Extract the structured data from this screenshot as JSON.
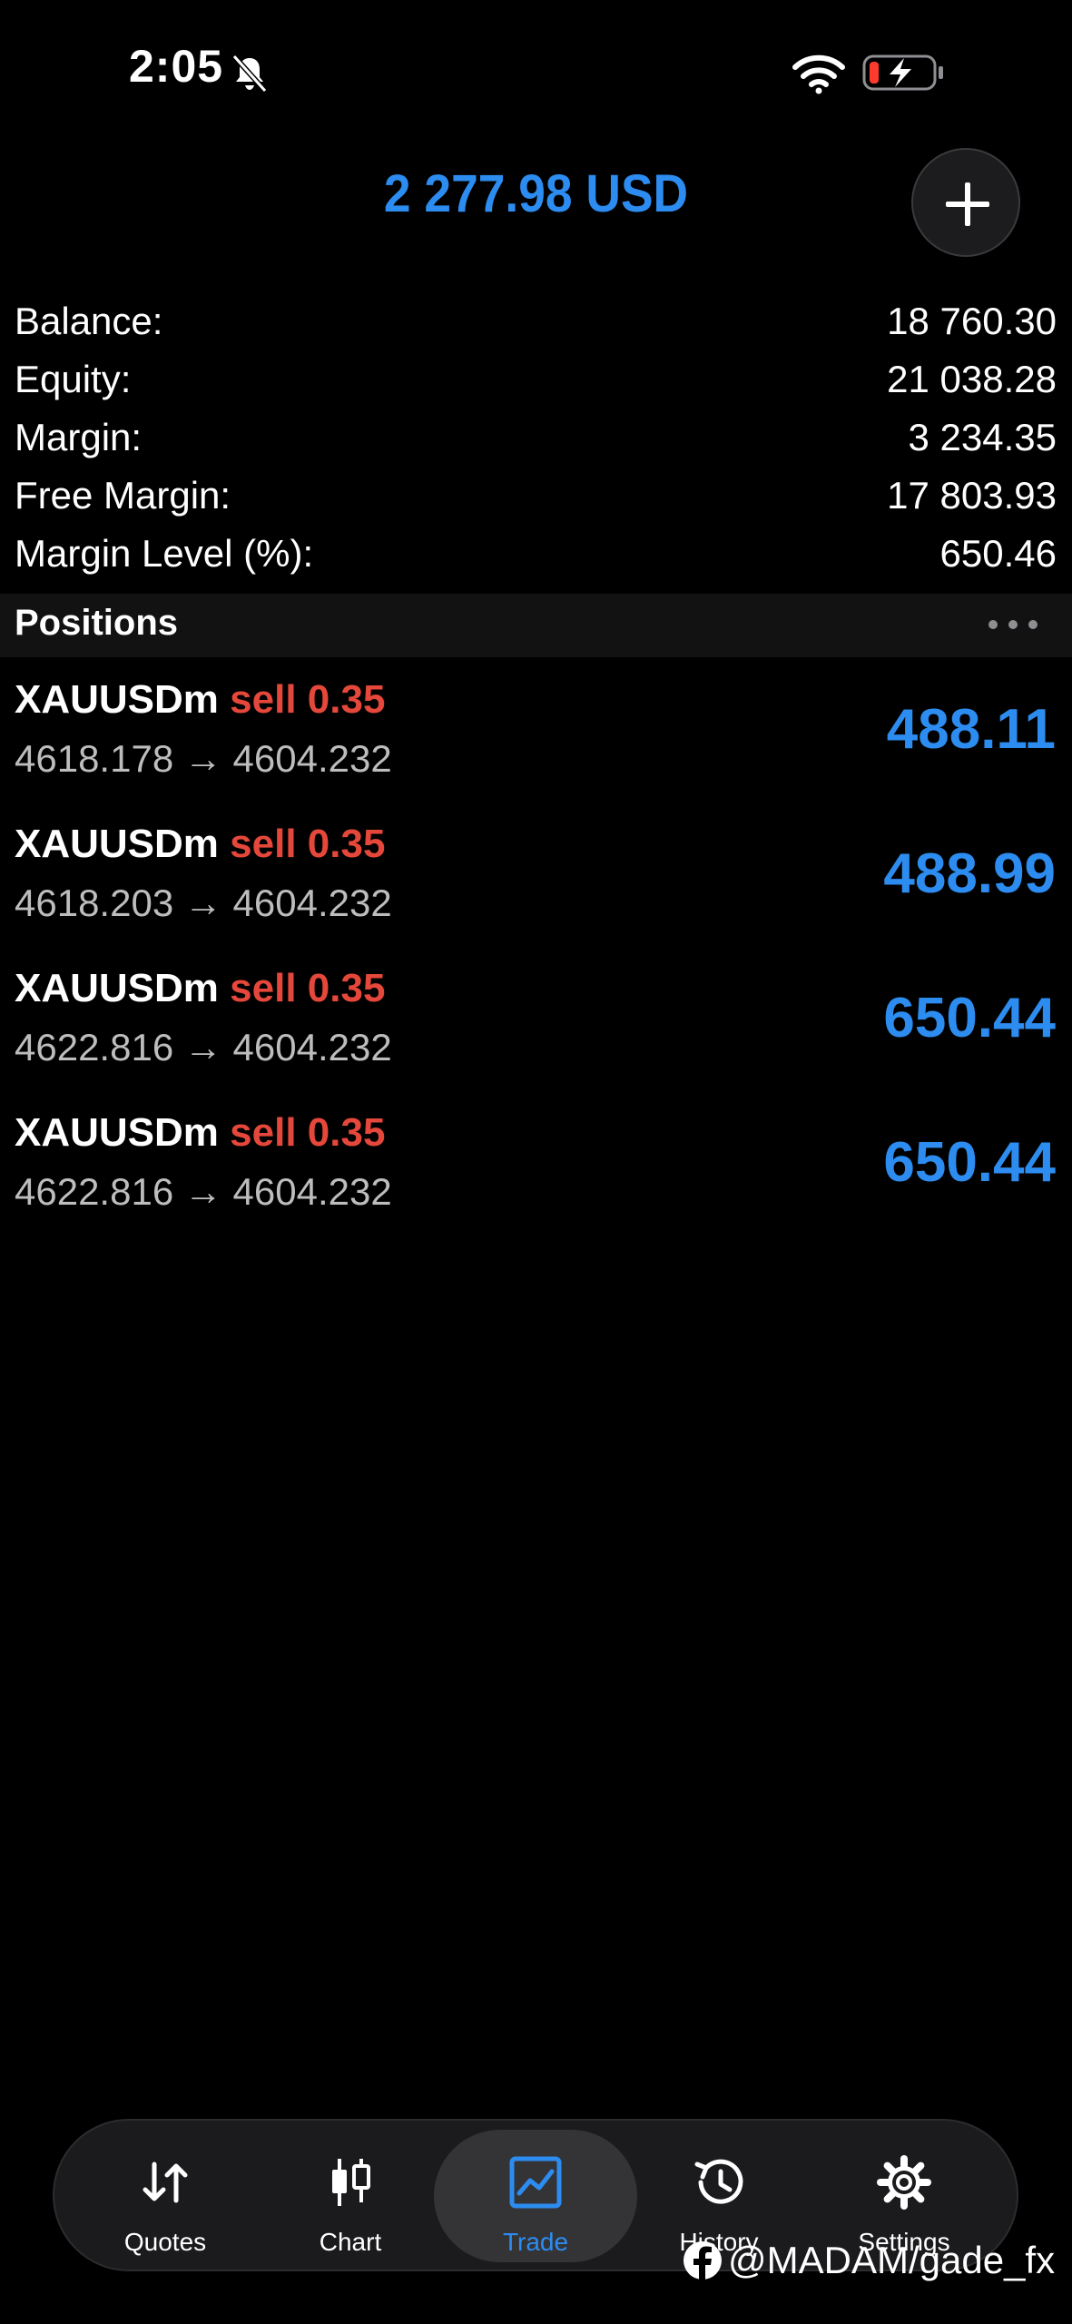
{
  "status_bar": {
    "time": "2:05"
  },
  "header": {
    "total": "2 277.98 USD"
  },
  "summary": [
    {
      "label": "Balance:",
      "value": "18 760.30"
    },
    {
      "label": "Equity:",
      "value": "21 038.28"
    },
    {
      "label": "Margin:",
      "value": "3 234.35"
    },
    {
      "label": "Free Margin:",
      "value": "17 803.93"
    },
    {
      "label": "Margin Level (%):",
      "value": "650.46"
    }
  ],
  "positions": {
    "title": "Positions",
    "items": [
      {
        "symbol": "XAUUSDm",
        "side": "sell 0.35",
        "prices": "4618.178 → 4604.232",
        "profit": "488.11"
      },
      {
        "symbol": "XAUUSDm",
        "side": "sell 0.35",
        "prices": "4618.203 → 4604.232",
        "profit": "488.99"
      },
      {
        "symbol": "XAUUSDm",
        "side": "sell 0.35",
        "prices": "4622.816 → 4604.232",
        "profit": "650.44"
      },
      {
        "symbol": "XAUUSDm",
        "side": "sell 0.35",
        "prices": "4622.816 → 4604.232",
        "profit": "650.44"
      }
    ]
  },
  "tabs": [
    {
      "label": "Quotes",
      "icon": "quotes-arrows-icon"
    },
    {
      "label": "Chart",
      "icon": "candlestick-icon"
    },
    {
      "label": "Trade",
      "icon": "trade-chart-icon",
      "active": true
    },
    {
      "label": "History",
      "icon": "history-clock-icon"
    },
    {
      "label": "Settings",
      "icon": "gear-icon"
    }
  ],
  "watermark": {
    "text": "@MADAM/gade_fx"
  },
  "colors": {
    "accent": "#2d8cf0",
    "sell": "#e5483b",
    "background": "#000000"
  }
}
